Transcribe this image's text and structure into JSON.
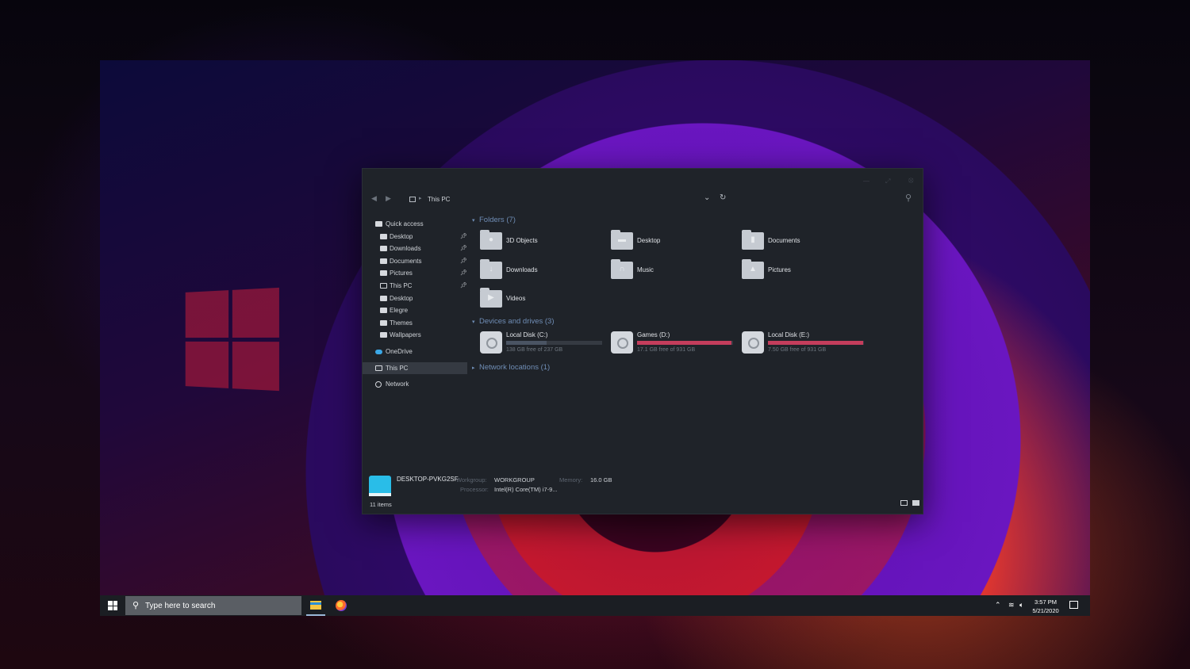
{
  "explorer": {
    "breadcrumb": "This PC",
    "nav": {
      "quick_access": "Quick access",
      "qa_items": [
        {
          "label": "Desktop",
          "pinned": true
        },
        {
          "label": "Downloads",
          "pinned": true
        },
        {
          "label": "Documents",
          "pinned": true
        },
        {
          "label": "Pictures",
          "pinned": true
        },
        {
          "label": "This PC",
          "pinned": true
        },
        {
          "label": "Desktop",
          "pinned": false
        },
        {
          "label": "Elegre",
          "pinned": false
        },
        {
          "label": "Themes",
          "pinned": false
        },
        {
          "label": "Wallpapers",
          "pinned": false
        }
      ],
      "onedrive": "OneDrive",
      "this_pc": "This PC",
      "network": "Network"
    },
    "groups": {
      "folders": "Folders (7)",
      "devices": "Devices and drives (3)",
      "network": "Network locations (1)"
    },
    "folders": [
      {
        "label": "3D Objects",
        "icon": "cube-icon"
      },
      {
        "label": "Desktop",
        "icon": "desktop-icon"
      },
      {
        "label": "Documents",
        "icon": "document-icon"
      },
      {
        "label": "Downloads",
        "icon": "download-icon"
      },
      {
        "label": "Music",
        "icon": "headphones-icon"
      },
      {
        "label": "Pictures",
        "icon": "picture-icon"
      },
      {
        "label": "Videos",
        "icon": "play-icon"
      }
    ],
    "drives": [
      {
        "name": "Local Disk (C:)",
        "free": "138 GB free of 237 GB",
        "used_fraction": 0.42,
        "color": "#4a5463"
      },
      {
        "name": "Games (D:)",
        "free": "17.1 GB free of 931 GB",
        "used_fraction": 0.98,
        "color": "#c43d5c"
      },
      {
        "name": "Local Disk (E:)",
        "free": "7.50 GB free of 931 GB",
        "used_fraction": 0.99,
        "color": "#c43d5c"
      }
    ],
    "details": {
      "pc_name": "DESKTOP-PVKG2SF",
      "workgroup_label": "Workgroup:",
      "workgroup_value": "WORKGROUP",
      "memory_label": "Memory:",
      "memory_value": "16.0 GB",
      "processor_label": "Processor:",
      "processor_value": "Intel(R) Core(TM) i7-9...",
      "item_count": "11 items"
    }
  },
  "taskbar": {
    "search_placeholder": "Type here to search",
    "time": "3:57 PM",
    "date": "5/21/2020"
  }
}
